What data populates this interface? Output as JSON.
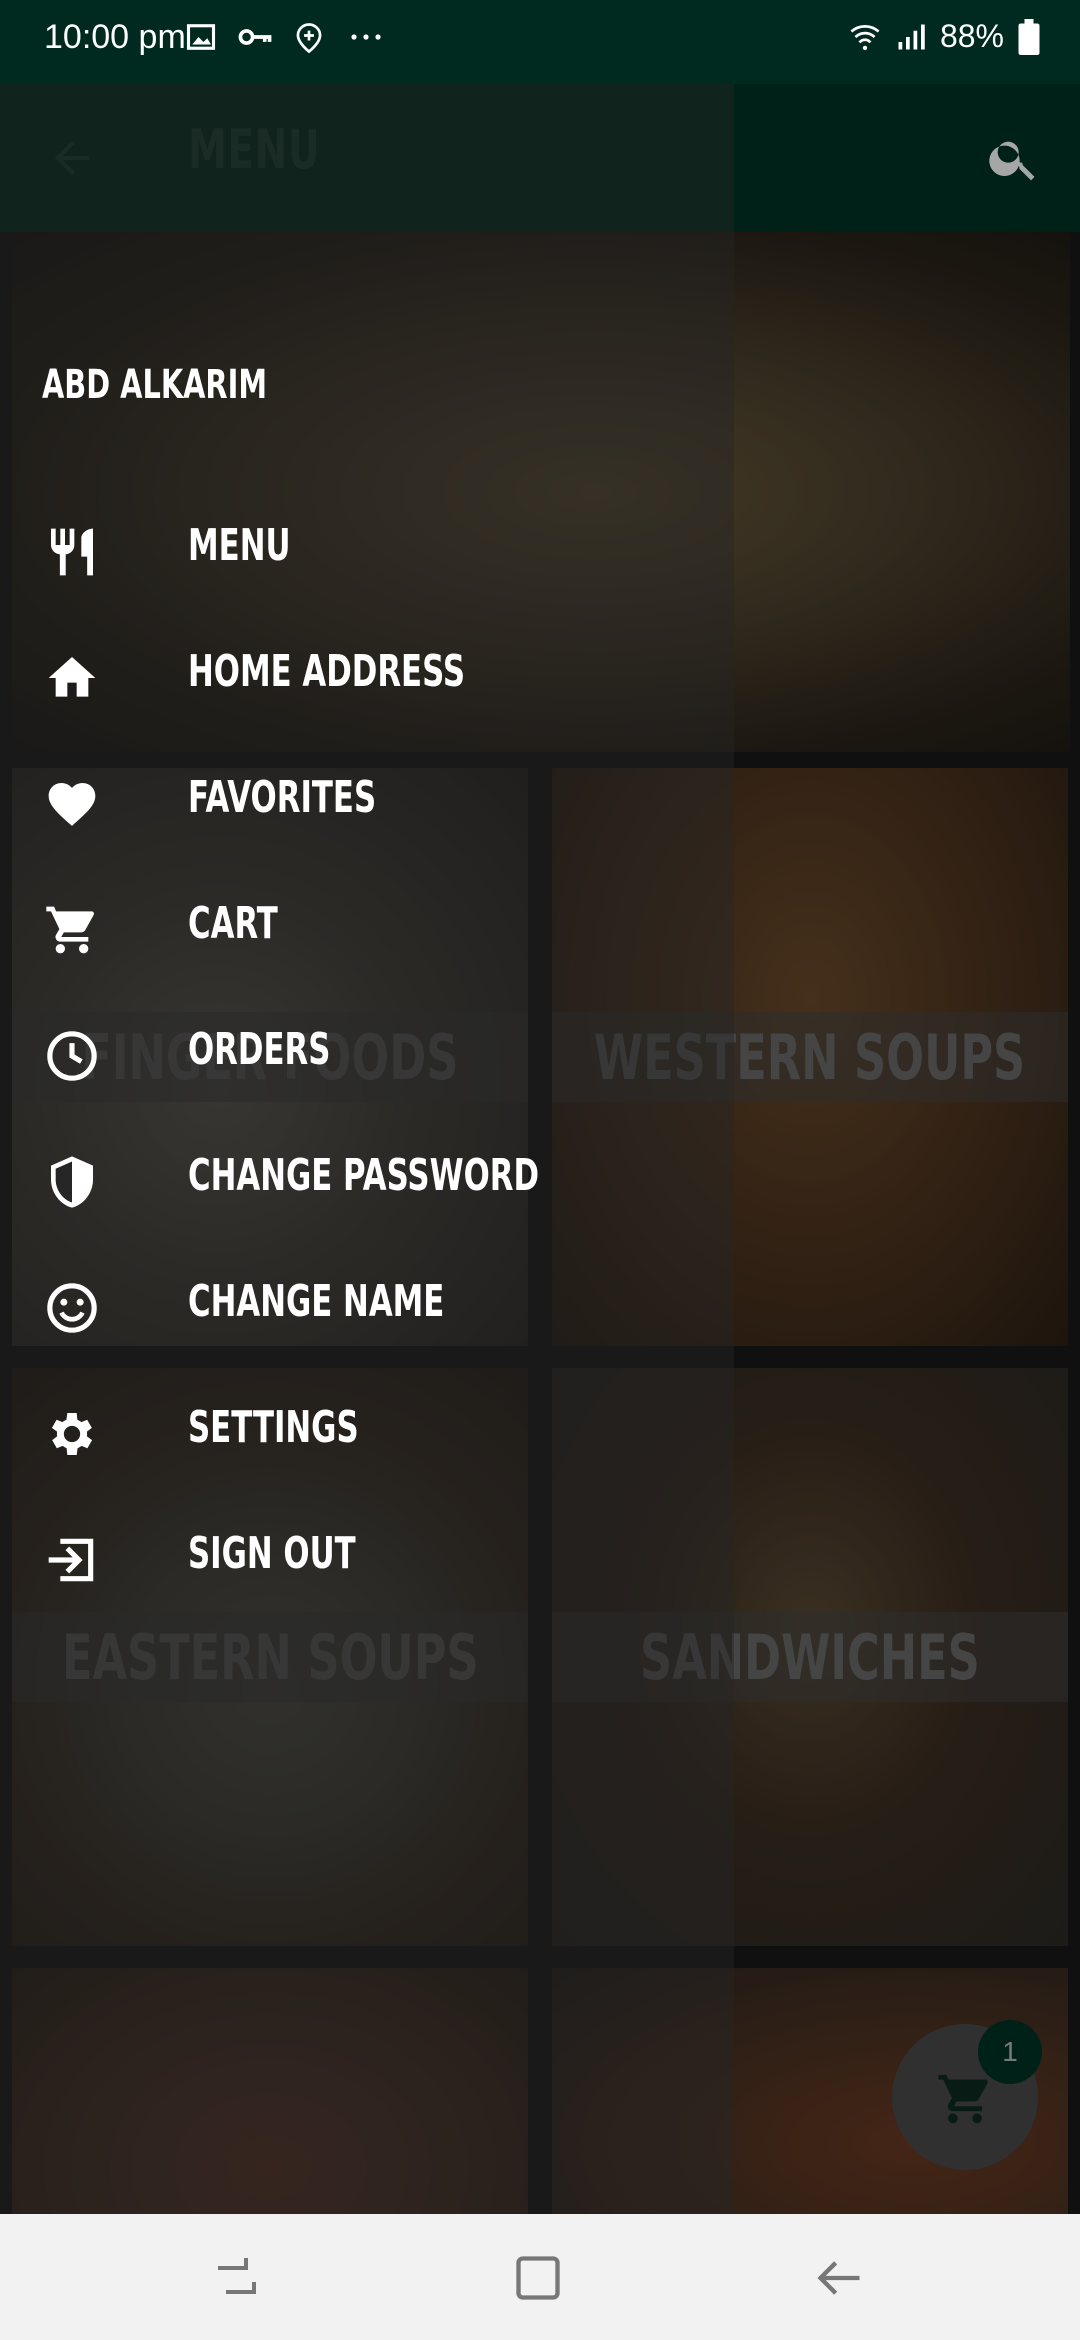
{
  "status_bar": {
    "time": "10:00 pm",
    "battery": "88%",
    "icons": [
      "image-icon",
      "key-icon",
      "location-add-icon",
      "more-dots-icon",
      "wifi-icon",
      "signal-icon",
      "battery-icon"
    ]
  },
  "app_bar": {
    "title": "MENU",
    "back_icon": "arrow-back-icon",
    "search_icon": "search-icon"
  },
  "categories": [
    {
      "label": ""
    },
    {
      "label": "FINGER FOODS"
    },
    {
      "label": "WESTERN SOUPS"
    },
    {
      "label": "EASTERN SOUPS"
    },
    {
      "label": "SANDWICHES"
    },
    {
      "label": ""
    },
    {
      "label": ""
    }
  ],
  "drawer": {
    "user_name": "ABD ALKARIM",
    "items": [
      {
        "label": "MENU",
        "icon": "restaurant-icon"
      },
      {
        "label": "HOME ADDRESS",
        "icon": "home-icon"
      },
      {
        "label": "FAVORITES",
        "icon": "heart-icon"
      },
      {
        "label": "CART",
        "icon": "cart-icon"
      },
      {
        "label": "ORDERS",
        "icon": "clock-icon"
      },
      {
        "label": "CHANGE PASSWORD",
        "icon": "shield-icon"
      },
      {
        "label": "CHANGE NAME",
        "icon": "smiley-icon"
      },
      {
        "label": "SETTINGS",
        "icon": "gear-icon"
      },
      {
        "label": "SIGN OUT",
        "icon": "sign-out-icon"
      }
    ]
  },
  "cart_fab": {
    "icon": "cart-icon",
    "badge_count": "1"
  },
  "nav_bar": {
    "icons": [
      "recent-apps-icon",
      "home-button-icon",
      "back-nav-icon"
    ]
  },
  "colors": {
    "primary_dark": "#002a1f",
    "primary": "#003324",
    "drawer_text": "#ffffff",
    "nav_bar_bg": "#f2f2f2"
  }
}
